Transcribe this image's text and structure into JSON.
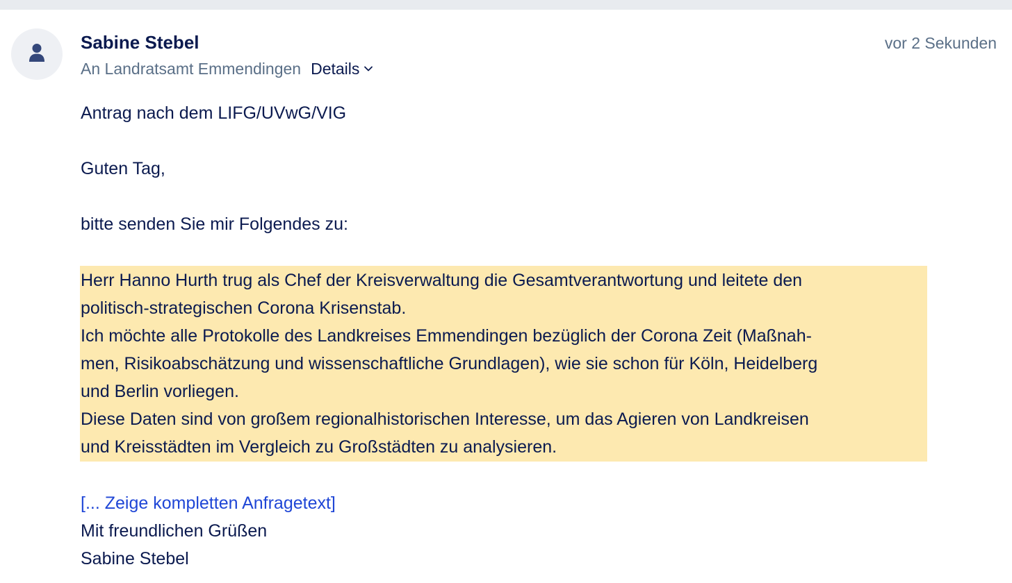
{
  "message": {
    "sender_name": "Sabine Stebel",
    "timestamp": "vor 2 Sekunden",
    "recipient": "An Landratsamt Emmendingen",
    "details_label": "Details",
    "avatar_icon": "user-icon",
    "subject": "Antrag nach dem LIFG/UVwG/VIG",
    "greeting": "Guten Tag,",
    "intro": "bitte senden Sie mir Folgendes zu:",
    "highlighted_lines": [
      "Herr Hanno Hurth trug als Chef der Kreisverwaltung die Gesamtverantwortung und leitete den",
      "politisch-strategischen Corona Krisenstab.",
      "Ich möchte alle Protokolle des Landkreises Emmendingen bezüglich der Corona Zeit (Maßnah-",
      "men, Risikoabschätzung und wissenschaftliche Grundlagen), wie sie schon für Köln, Heidelberg",
      "und Berlin vorliegen.",
      "Diese Daten sind von großem regionalhistorischen Interesse, um das Agieren von Landkreisen",
      "und Kreisstädten im Vergleich zu Großstädten zu analysieren."
    ],
    "show_full_link": "[... Zeige kompletten Anfragetext]",
    "closing": "Mit freundlichen Grüßen",
    "signature": "Sabine Stebel"
  },
  "colors": {
    "text": "#0b1a4f",
    "muted": "#5a6f87",
    "link": "#1f46d6",
    "highlight": "#fde9b0",
    "avatar_bg": "#eef0f4",
    "avatar_icon": "#34477a"
  }
}
